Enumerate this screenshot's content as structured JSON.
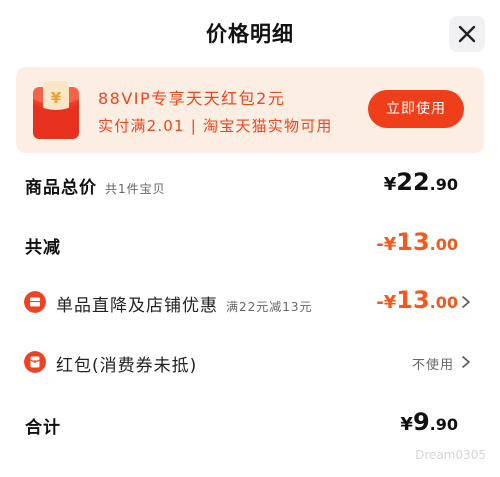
{
  "header": {
    "title": "价格明细"
  },
  "banner": {
    "line1": "88VIP专享天天红包2元",
    "line2": "实付满2.01 | 淘宝天猫实物可用",
    "button": "立即使用",
    "packet_symbol": "¥"
  },
  "rows": {
    "subtotal": {
      "label": "商品总价",
      "sub": "共1件宝贝",
      "currency": "¥",
      "int": "22",
      "dec": ".90"
    },
    "reduction": {
      "label": "共减",
      "currency": "-¥",
      "int": "13",
      "dec": ".00"
    },
    "shop_discount": {
      "label": "单品直降及店铺优惠",
      "sub": "满22元减13元",
      "currency": "-¥",
      "int": "13",
      "dec": ".00"
    },
    "red_packet": {
      "label": "红包(消费券未抵)",
      "status": "不使用"
    },
    "total": {
      "label": "合计",
      "currency": "¥",
      "int": "9",
      "dec": ".90"
    }
  },
  "watermark": "Dream0305",
  "colors": {
    "accent": "#ee3f1a",
    "banner_bg": "#fdeee3",
    "discount": "#f25a1d"
  }
}
